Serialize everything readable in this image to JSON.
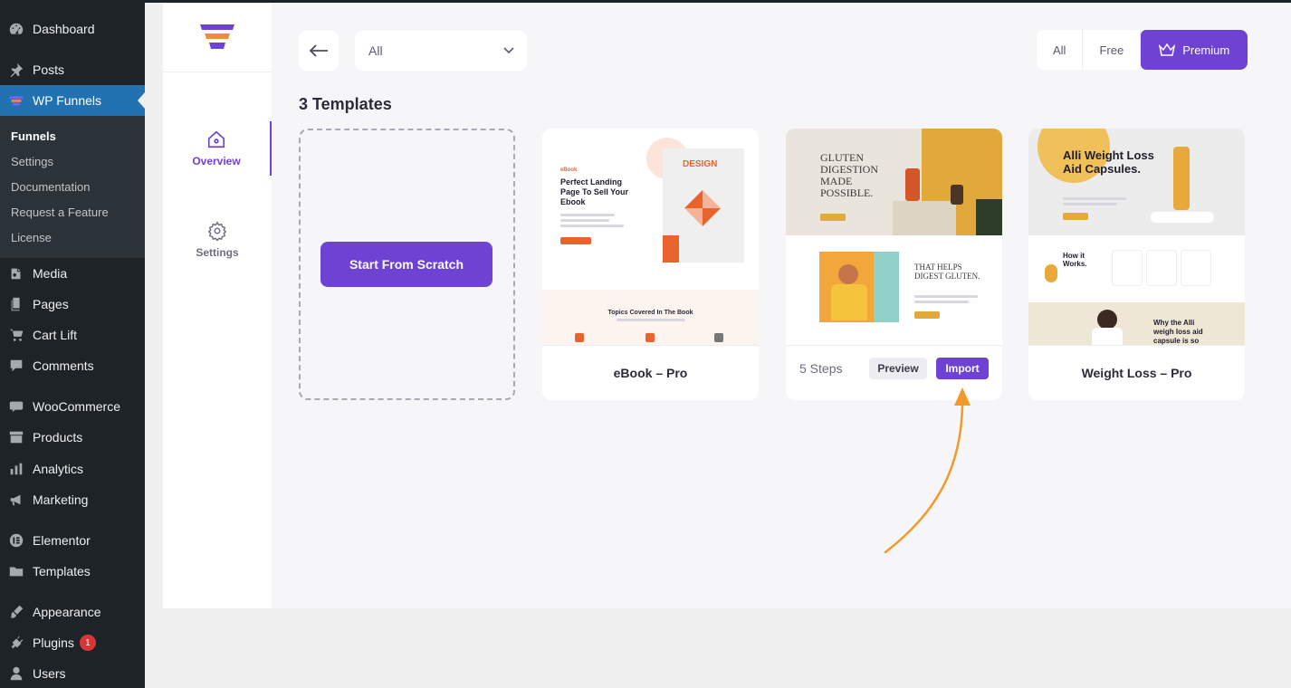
{
  "wp_menu": {
    "dashboard": "Dashboard",
    "posts": "Posts",
    "wp_funnels": "WP Funnels",
    "submenu": [
      "Funnels",
      "Settings",
      "Documentation",
      "Request a Feature",
      "License"
    ],
    "media": "Media",
    "pages": "Pages",
    "cart_lift": "Cart Lift",
    "comments": "Comments",
    "woocommerce": "WooCommerce",
    "products": "Products",
    "analytics": "Analytics",
    "marketing": "Marketing",
    "elementor": "Elementor",
    "templates": "Templates",
    "appearance": "Appearance",
    "plugins": "Plugins",
    "plugins_badge": "1",
    "users": "Users"
  },
  "plugin_nav": {
    "overview": "Overview",
    "settings": "Settings"
  },
  "toolbar": {
    "filter_value": "All",
    "type_all": "All",
    "type_free": "Free",
    "type_premium": "Premium"
  },
  "templates_count": "3 Templates",
  "scratch": {
    "button": "Start From Scratch"
  },
  "templates": [
    {
      "name": "eBook – Pro",
      "thumb_tag": "eBook",
      "thumb_title": "Perfect Landing Page To Sell Your Ebook",
      "thumb_book": "DESIGN",
      "thumb_sub": "Topics Covered In The Book"
    },
    {
      "steps": "5 Steps",
      "preview": "Preview",
      "import": "Import",
      "thumb_title": "GLUTEN DIGESTION MADE POSSIBLE.",
      "thumb_title2": "THAT HELPS DIGEST GLUTEN."
    },
    {
      "name": "Weight Loss – Pro",
      "thumb_title": "Alli Weight Loss Aid Capsules.",
      "thumb_how": "How it Works.",
      "thumb_why": "Why the Alli weigh loss aid capsule is so"
    }
  ],
  "colors": {
    "accent": "#6e42d3",
    "wp_sidebar": "#1d2327",
    "wp_active": "#2271b1",
    "arrow": "#f09a2a"
  }
}
